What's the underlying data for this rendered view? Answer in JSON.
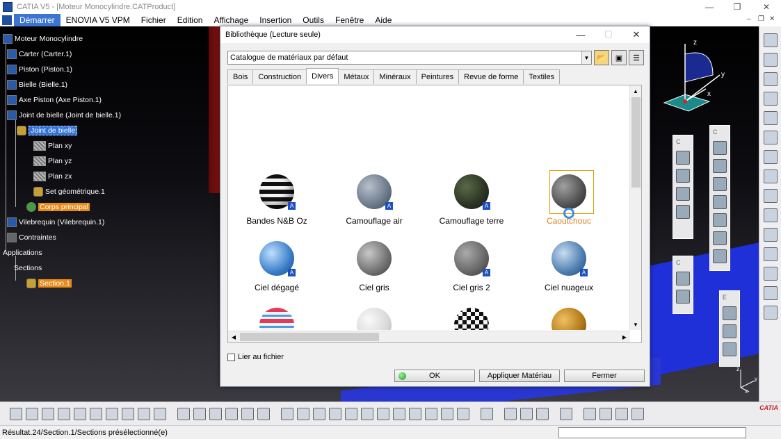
{
  "window": {
    "title": "CATIA V5 - [Moteur Monocylindre.CATProduct]",
    "minimize": "—",
    "restore": "❐",
    "close": "✕"
  },
  "menubar": {
    "items": [
      "Démarrer",
      "ENOVIA V5 VPM",
      "Fichier",
      "Edition",
      "Affichage",
      "Insertion",
      "Outils",
      "Fenêtre",
      "Aide"
    ],
    "doc_minimize": "–",
    "doc_restore": "❐",
    "doc_close": "✕"
  },
  "tree": {
    "root": "Moteur Monocylindre",
    "items": [
      {
        "label": "Carter (Carter.1)"
      },
      {
        "label": "Piston (Piston.1)"
      },
      {
        "label": "Bielle (Bielle.1)"
      },
      {
        "label": "Axe Piston (Axe Piston.1)"
      },
      {
        "label": "Joint de bielle (Joint de bielle.1)"
      },
      {
        "label": "Joint de bielle"
      },
      {
        "label": "Plan xy"
      },
      {
        "label": "Plan yz"
      },
      {
        "label": "Plan zx"
      },
      {
        "label": "Set géométrique.1"
      },
      {
        "label": "Corps principal"
      },
      {
        "label": "Vilebrequin (Vilebrequin.1)"
      },
      {
        "label": "Contraintes"
      },
      {
        "label": "Applications"
      },
      {
        "label": "Sections"
      },
      {
        "label": "Section.1"
      }
    ]
  },
  "compass": {
    "x": "x",
    "y": "y",
    "z": "z"
  },
  "triad": {
    "x": "x",
    "y": "y",
    "z": "z"
  },
  "dialog": {
    "title": "Bibliothèque (Lecture seule)",
    "minimize": "—",
    "maximize": "☐",
    "close": "✕",
    "catalog_value": "Catalogue de matériaux par défaut",
    "tabs": [
      "Bois",
      "Construction",
      "Divers",
      "Métaux",
      "Minéraux",
      "Peintures",
      "Revue de forme",
      "Textiles"
    ],
    "active_tab": "Divers",
    "materials": [
      {
        "label": "Bandes N&B Oz",
        "swatch": "stripes-bw"
      },
      {
        "label": "Camouflage air",
        "swatch": "camo-air"
      },
      {
        "label": "Camouflage terre",
        "swatch": "camo-earth"
      },
      {
        "label": "Caoutchouc",
        "swatch": "rubber",
        "selected": true
      },
      {
        "label": "Ciel dégagé",
        "swatch": "sky-clear"
      },
      {
        "label": "Ciel gris",
        "swatch": "sky-grey"
      },
      {
        "label": "Ciel gris 2",
        "swatch": "sky-grey-2"
      },
      {
        "label": "Ciel nuageux",
        "swatch": "sky-cloudy"
      },
      {
        "label": "",
        "swatch": "stripes-pink"
      },
      {
        "label": "",
        "swatch": "white"
      },
      {
        "label": "",
        "swatch": "checker"
      },
      {
        "label": "",
        "swatch": "gold"
      }
    ],
    "link_label": "Lier au fichier",
    "ok_label": "OK",
    "apply_label": "Appliquer Matériau",
    "close_label": "Fermer"
  },
  "colors": {
    "accent": "#3b74d1",
    "selection_orange": "#e88a18",
    "badge_blue": "#1d4fbf"
  },
  "status": {
    "text": "Résultat.24/Section.1/Sections présélectionné(e)"
  },
  "logo": "CATIA"
}
